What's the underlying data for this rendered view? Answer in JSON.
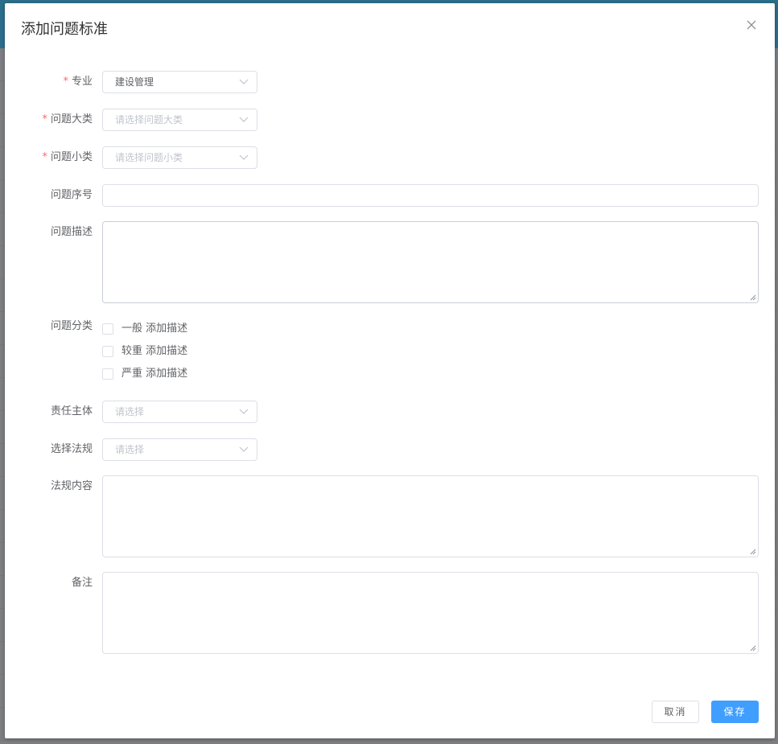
{
  "dialog": {
    "title": "添加问题标准",
    "close_icon": "close-icon"
  },
  "form": {
    "major": {
      "label": "专业",
      "required": true,
      "value": "建设管理"
    },
    "category": {
      "label": "问题大类",
      "required": true,
      "placeholder": "请选择问题大类"
    },
    "subcategory": {
      "label": "问题小类",
      "required": true,
      "placeholder": "请选择问题小类"
    },
    "serial_no": {
      "label": "问题序号",
      "value": ""
    },
    "description": {
      "label": "问题描述",
      "value": ""
    },
    "classification": {
      "label": "问题分类",
      "options": [
        {
          "label": "一般 添加描述",
          "checked": false
        },
        {
          "label": "较重 添加描述",
          "checked": false
        },
        {
          "label": "严重 添加描述",
          "checked": false
        }
      ]
    },
    "responsible": {
      "label": "责任主体",
      "placeholder": "请选择"
    },
    "regulation": {
      "label": "选择法规",
      "placeholder": "请选择"
    },
    "regulation_content": {
      "label": "法规内容",
      "value": ""
    },
    "remarks": {
      "label": "备注",
      "value": ""
    }
  },
  "footer": {
    "cancel_label": "取消",
    "save_label": "保存"
  },
  "colors": {
    "primary": "#409eff",
    "required": "#f56c6c",
    "border": "#dcdfe6"
  }
}
